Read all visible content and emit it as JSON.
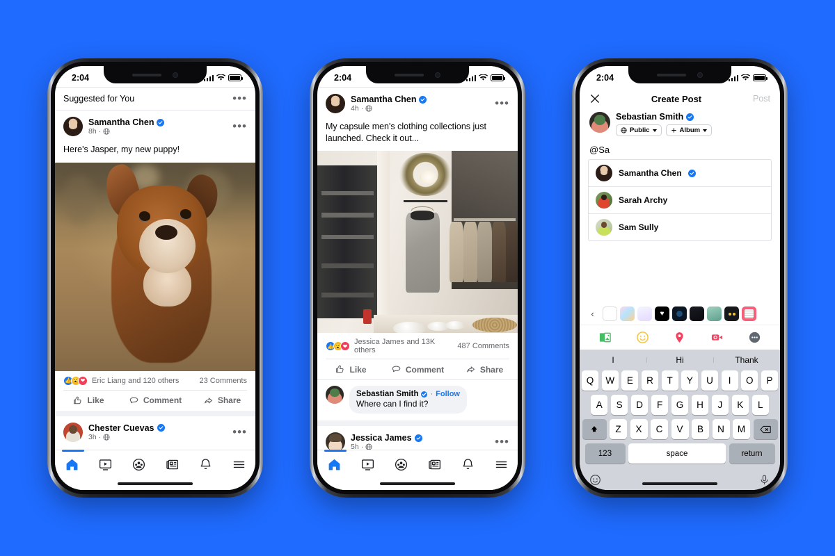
{
  "background_color": "#1f6bff",
  "accent_color": "#1877f2",
  "phones": [
    {
      "id": "feed-suggested",
      "status_bar": {
        "time": "2:04"
      },
      "section_header": {
        "label": "Suggested for You",
        "menu_icon": "ellipsis-icon"
      },
      "posts": [
        {
          "author": "Samantha Chen",
          "verified": true,
          "time": "8h",
          "privacy_icon": "globe-icon",
          "menu_icon": "ellipsis-icon",
          "text": "Here's Jasper, my new puppy!",
          "photo_alt": "brown and white bulldog puppy running on dry grass",
          "reactions": {
            "icons": [
              "like-icon",
              "wow-icon",
              "love-icon"
            ],
            "summary": "Eric Liang and 120 others",
            "comments": "23 Comments"
          },
          "actions": [
            "Like",
            "Comment",
            "Share"
          ]
        },
        {
          "author": "Chester Cuevas",
          "verified": true,
          "time": "3h",
          "privacy_icon": "globe-icon",
          "menu_icon": "ellipsis-icon"
        }
      ],
      "tabbar": {
        "active_index": 0,
        "items": [
          "home-icon",
          "watch-icon",
          "groups-icon",
          "news-icon",
          "notifications-icon",
          "menu-icon"
        ]
      }
    },
    {
      "id": "feed-post-detail",
      "status_bar": {
        "time": "2:04"
      },
      "posts": [
        {
          "author": "Samantha Chen",
          "verified": true,
          "time": "4h",
          "privacy_icon": "globe-icon",
          "menu_icon": "ellipsis-icon",
          "text": "My capsule men's clothing collections just launched. Check it out...",
          "photo_alt": "boutique interior with grey overcoat hanging on white wall and rack of jackets",
          "reactions": {
            "icons": [
              "like-icon",
              "wow-icon",
              "love-icon"
            ],
            "summary": "Jessica James and 13K others",
            "comments": "487 Comments"
          },
          "actions": [
            "Like",
            "Comment",
            "Share"
          ],
          "comment": {
            "author": "Sebastian Smith",
            "verified": true,
            "follow_label": "Follow",
            "text": "Where can I find it?"
          }
        },
        {
          "author": "Jessica James",
          "verified": true,
          "time": "5h",
          "privacy_icon": "globe-icon",
          "menu_icon": "ellipsis-icon"
        }
      ],
      "tabbar": {
        "active_index": 0,
        "items": [
          "home-icon",
          "watch-icon",
          "groups-icon",
          "news-icon",
          "notifications-icon",
          "menu-icon"
        ]
      }
    },
    {
      "id": "create-post",
      "status_bar": {
        "time": "2:04"
      },
      "header": {
        "close_icon": "close-icon",
        "title": "Create Post",
        "post_label": "Post"
      },
      "composer": {
        "author": "Sebastian Smith",
        "verified": true,
        "audience_pill": {
          "icon": "globe-icon",
          "label": "Public",
          "caret": "chevron-down-icon"
        },
        "album_pill": {
          "icon": "plus-icon",
          "label": "Album",
          "caret": "chevron-down-icon"
        },
        "text": "@Sa"
      },
      "mention_suggestions": [
        {
          "name": "Samantha Chen",
          "verified": true
        },
        {
          "name": "Sarah Archy",
          "verified": false
        },
        {
          "name": "Sam Sully",
          "verified": false
        }
      ],
      "sticker_bar": {
        "back_icon": "chevron-left-icon",
        "stickers": [
          "blank-sticker",
          "pastel-art-sticker",
          "ice-cream-sticker",
          "black-heart-sticker",
          "record-sticker",
          "rain-sticker",
          "palm-sticker",
          "eyes-sticker",
          "grid-sticker"
        ]
      },
      "composer_toolbar": [
        "photo-icon",
        "emoji-icon",
        "location-icon",
        "live-video-icon",
        "more-icon"
      ],
      "keyboard": {
        "predictions": [
          "I",
          "Hi",
          "Thank"
        ],
        "row1": [
          "Q",
          "W",
          "E",
          "R",
          "T",
          "Y",
          "U",
          "I",
          "O",
          "P"
        ],
        "row2": [
          "A",
          "S",
          "D",
          "F",
          "G",
          "H",
          "J",
          "K",
          "L"
        ],
        "row3": [
          "Z",
          "X",
          "C",
          "V",
          "B",
          "N",
          "M"
        ],
        "shift_icon": "shift-icon",
        "delete_icon": "backspace-icon",
        "numbers_label": "123",
        "space_label": "space",
        "return_label": "return",
        "emoji_icon": "emoji-keyboard-icon",
        "mic_icon": "microphone-icon"
      }
    }
  ]
}
